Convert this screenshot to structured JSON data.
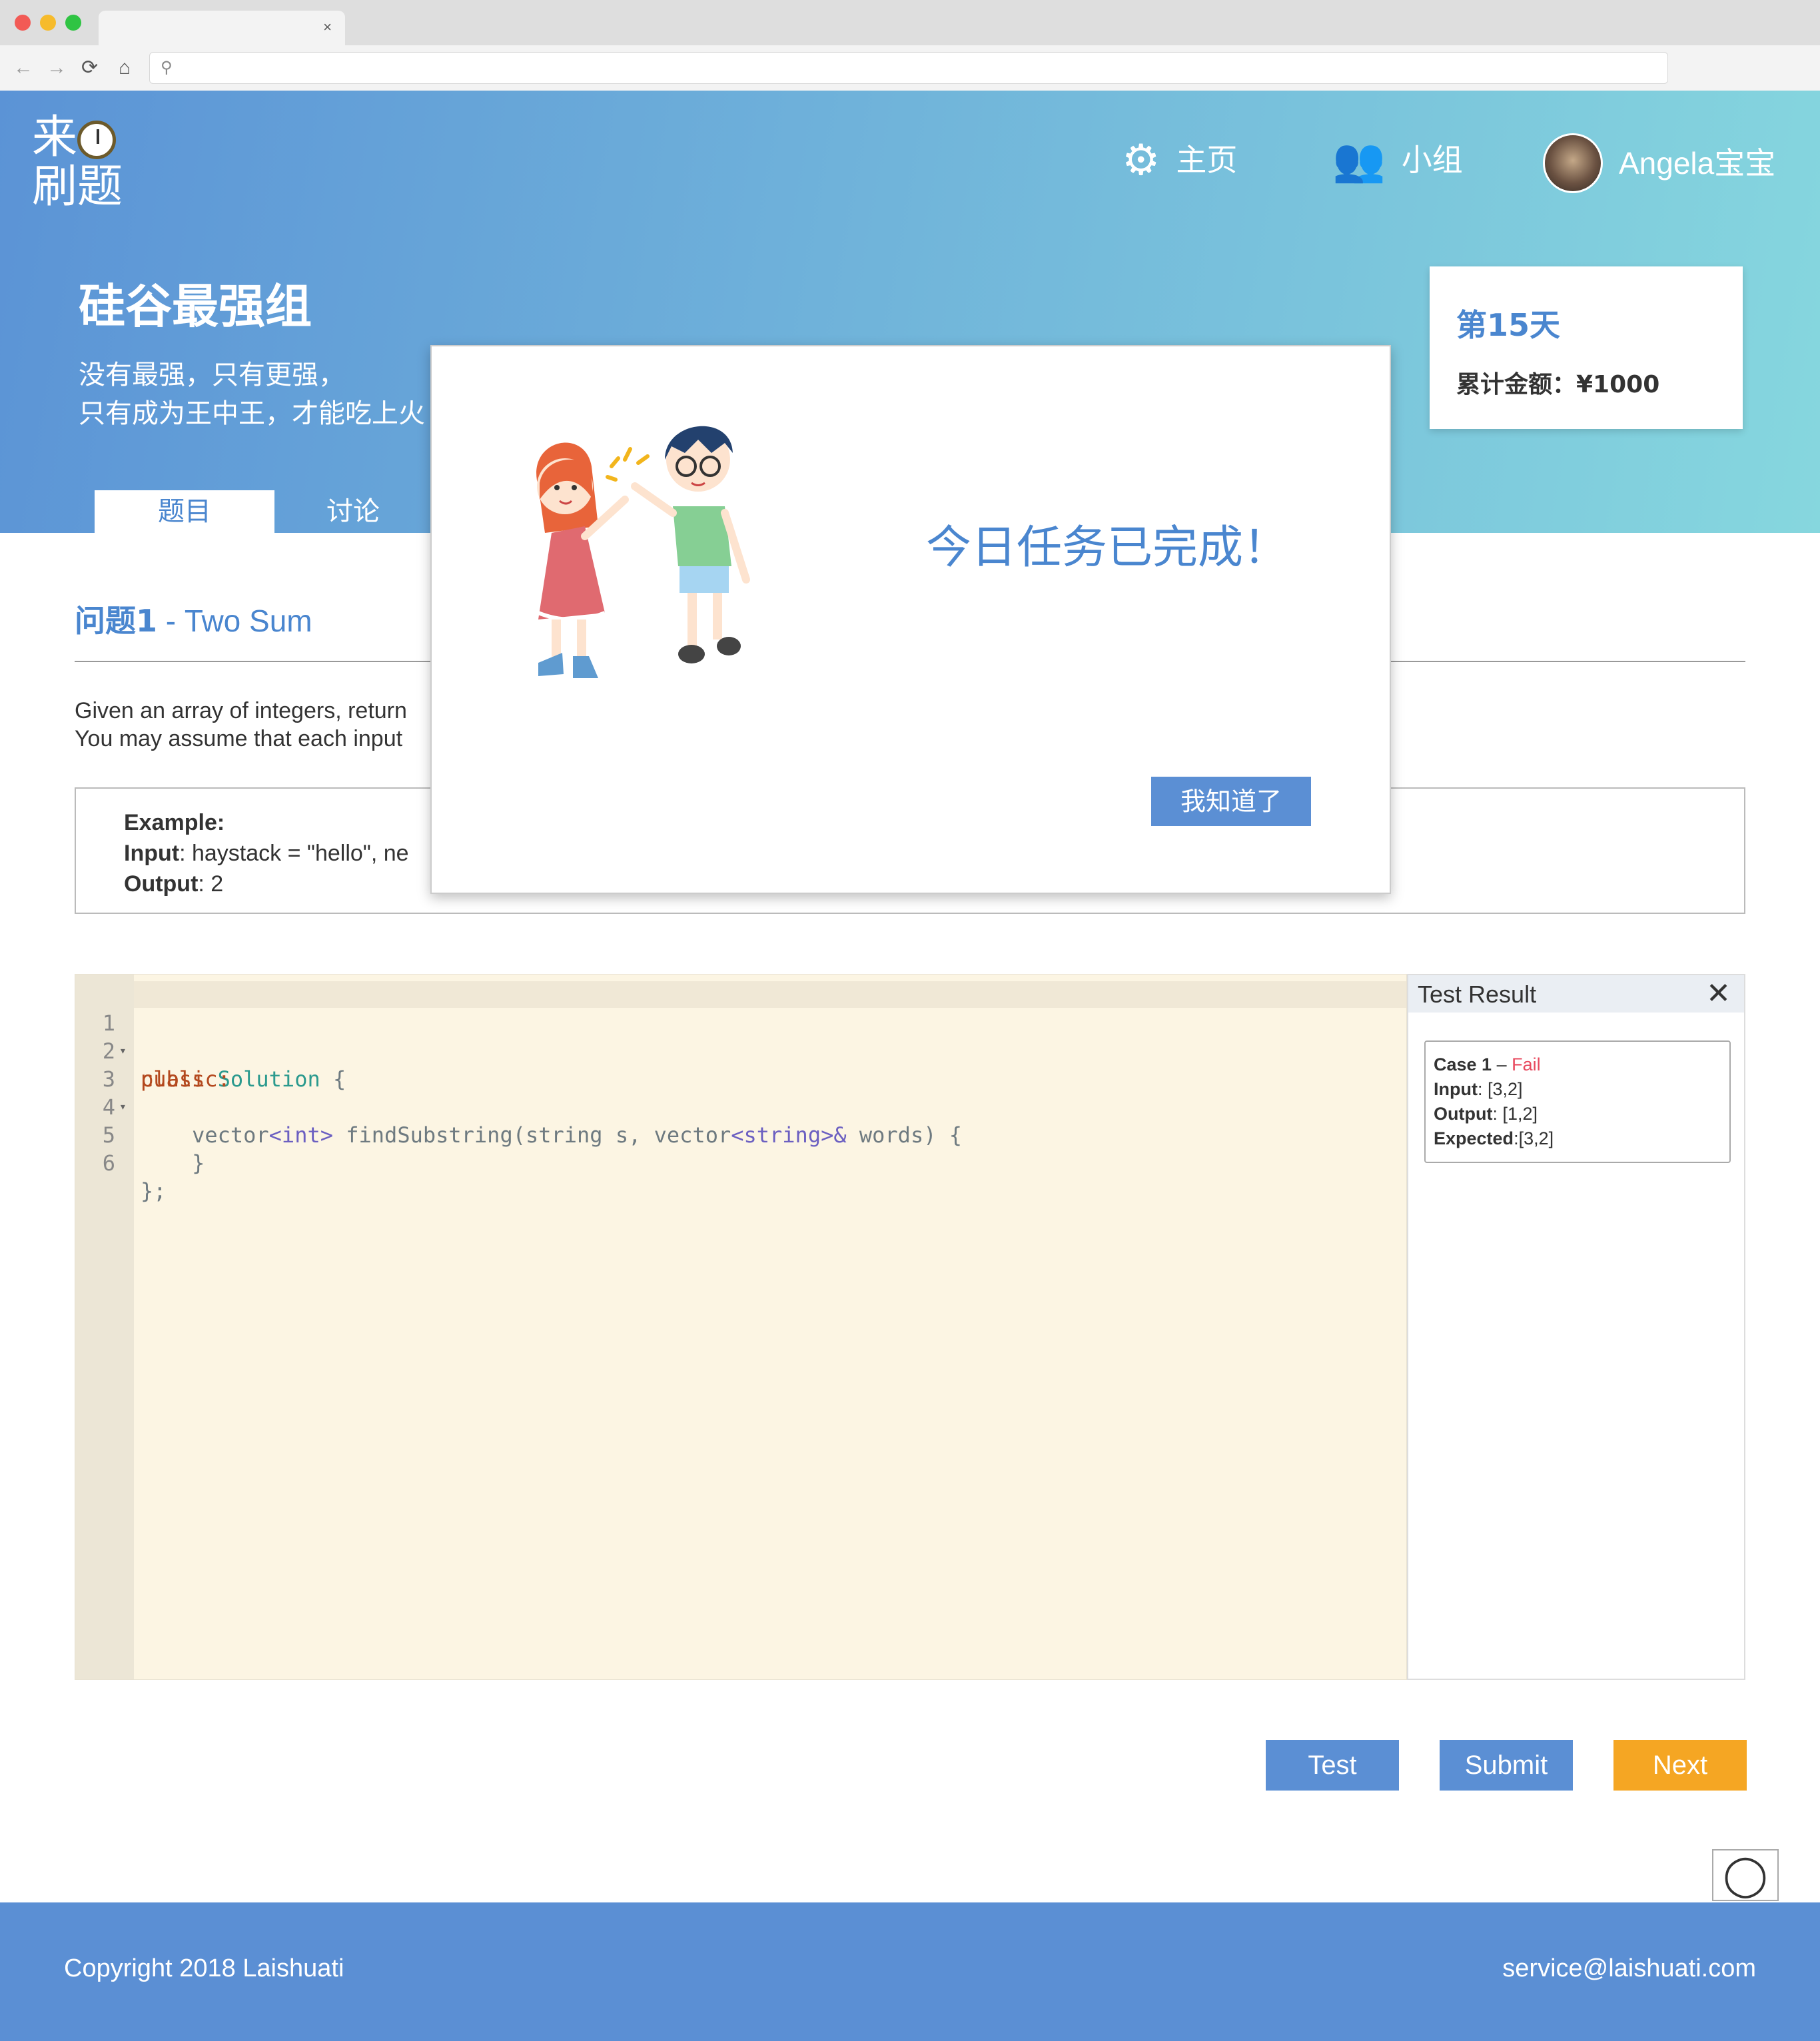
{
  "browser": {
    "close_glyph": "×",
    "back": "←",
    "forward": "→",
    "reload": "⟳",
    "home": "⌂",
    "search_glyph": "⚲"
  },
  "header": {
    "logo_top": "来",
    "logo_bottom": "刷题",
    "nav": [
      {
        "label": "主页",
        "icon": "gear-icon",
        "glyph": "⚙"
      },
      {
        "label": "小组",
        "icon": "users-icon",
        "glyph": "👥"
      }
    ],
    "user_name": "Angela宝宝"
  },
  "group": {
    "title": "硅谷最强组",
    "desc_line1": "没有最强，只有更强，",
    "desc_line2": "只有成为王中王，才能吃上火"
  },
  "progress_card": {
    "day": "第15天",
    "amount": "累计金额：¥1000"
  },
  "tabs": [
    {
      "label": "题目"
    },
    {
      "label": "讨论"
    }
  ],
  "question": {
    "prefix": "问题1",
    "title": " - Two Sum",
    "line1": "Given an array of integers, return",
    "line2": "You may assume that each input",
    "example_label": "Example:",
    "input_label": "Input",
    "input_value": ": haystack = \"hello\", ne",
    "output_label": "Output",
    "output_value": ": 2"
  },
  "editor": {
    "line_numbers": [
      "1",
      "2",
      "3",
      "4",
      "5",
      "6"
    ],
    "fold_marker": "▾",
    "l1_kw": "class",
    "l1_ty": "Solution",
    "l1_rest": " {",
    "l2_kw": "public:",
    "l3_a": "    vector",
    "l3_b": "<int>",
    "l3_c": " findSubstring(string s, vector",
    "l3_d": "<string>&",
    "l3_e": " words) {",
    "l5": "    }",
    "l6": "};"
  },
  "test_result": {
    "title": "Test Result",
    "close_glyph": "✕",
    "case_label": "Case 1",
    "dash": " – ",
    "status": "Fail",
    "input_label": "Input",
    "input_value": ": [3,2]",
    "output_label": "Output",
    "output_value": ": [1,2]",
    "expected_label": "Expected",
    "expected_value": ":[3,2]"
  },
  "buttons": {
    "test": "Test",
    "submit": "Submit",
    "next": "Next"
  },
  "feedback_glyph": "◯",
  "footer": {
    "copyright": "Copyright 2018 Laishuati",
    "email": "service@laishuati.com"
  },
  "modal": {
    "message": "今日任务已完成！",
    "confirm": "我知道了"
  },
  "colors": {
    "accent": "#4a86cf",
    "button_blue": "#5b8fd4",
    "button_orange": "#f5a623",
    "fail": "#e84a5f"
  }
}
